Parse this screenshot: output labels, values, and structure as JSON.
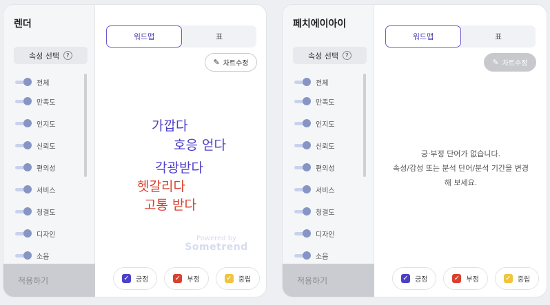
{
  "panels": [
    {
      "side_title": "렌더",
      "attr_select_label": "속성 선택",
      "help_icon": "?",
      "items": [
        "전체",
        "만족도",
        "인지도",
        "신뢰도",
        "편의성",
        "서비스",
        "청결도",
        "디자인",
        "소음"
      ],
      "apply_label": "적용하기",
      "tabs": [
        "워드맵",
        "표"
      ],
      "chart_edit_label": "차트수정",
      "words": [
        {
          "text": "가깝다",
          "sentiment": "positive"
        },
        {
          "text": "호응 얻다",
          "sentiment": "positive"
        },
        {
          "text": "각광받다",
          "sentiment": "positive"
        },
        {
          "text": "헷갈리다",
          "sentiment": "negative"
        },
        {
          "text": "고통 받다",
          "sentiment": "negative"
        }
      ],
      "powered_by": "Powered by",
      "brand": "Sometrend",
      "legend": [
        "긍정",
        "부정",
        "중립"
      ]
    },
    {
      "side_title": "페치에이아이",
      "attr_select_label": "속성 선택",
      "help_icon": "?",
      "items": [
        "전체",
        "만족도",
        "인지도",
        "신뢰도",
        "편의성",
        "서비스",
        "청결도",
        "디자인",
        "소음"
      ],
      "apply_label": "적용하기",
      "tabs": [
        "워드맵",
        "표"
      ],
      "chart_edit_label": "차트수정",
      "empty_line1": "긍·부정 단어가 없습니다.",
      "empty_line2": "속성/감성 또는 분석 단어/분석 기간을 변경",
      "empty_line3": "해 보세요.",
      "legend": [
        "긍정",
        "부정",
        "중립"
      ]
    }
  ],
  "colors": {
    "positive": "#4c3fc9",
    "negative": "#d9412f",
    "neutral": "#f0c43c",
    "accent": "#6a5acd"
  }
}
